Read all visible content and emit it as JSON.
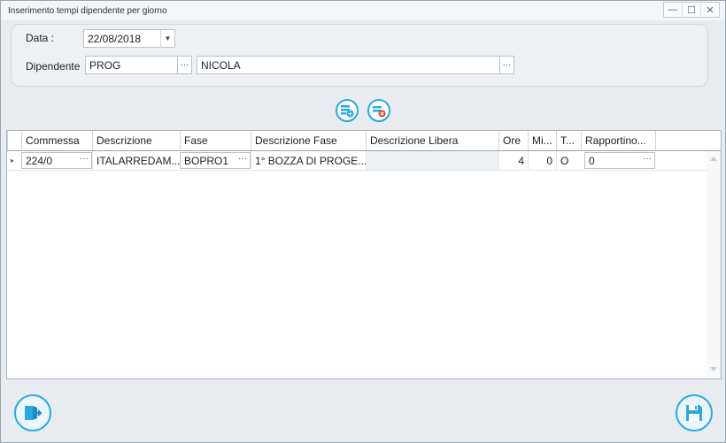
{
  "window": {
    "title": "Inserimento tempi dipendente per giorno",
    "controls": {
      "minimize": "—",
      "maximize": "☐",
      "close": "✕"
    }
  },
  "filter": {
    "date_label": "Data :",
    "date_value": "22/08/2018",
    "employee_label": "Dipendente",
    "employee_code": "PROG",
    "employee_name": "NICOLA",
    "ellipsis": "···"
  },
  "toolbar": {
    "add_row_icon": "add-row-icon",
    "delete_row_icon": "delete-row-icon"
  },
  "grid": {
    "columns": [
      "Commessa",
      "Descrizione",
      "Fase",
      "Descrizione Fase",
      "Descrizione Libera",
      "Ore",
      "Mi...",
      "T...",
      "Rapportino..."
    ],
    "rows": [
      {
        "indicator": "▸",
        "commessa": "224/0",
        "descrizione": "ITALARREDAM...",
        "fase": "BOPRO1",
        "descrizione_fase": "1° BOZZA DI PROGE...",
        "descrizione_libera": "",
        "ore": "4",
        "minuti": "0",
        "t": "O",
        "rapportino": "0"
      }
    ]
  },
  "footer": {
    "exit_icon": "exit-icon",
    "save_icon": "save-icon"
  },
  "colors": {
    "accent": "#2aa9e0",
    "border": "#a9b2bb",
    "background": "#e8ecf0"
  }
}
